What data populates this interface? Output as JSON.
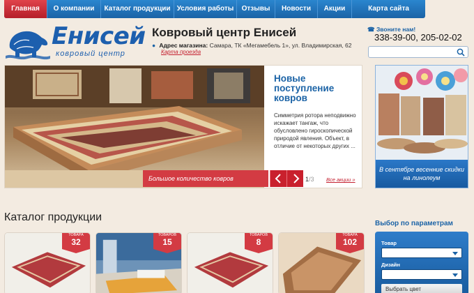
{
  "nav": {
    "items": [
      {
        "label": "Главная",
        "active": true
      },
      {
        "label": "О компании",
        "active": false
      },
      {
        "label": "Каталог продукции",
        "active": false
      },
      {
        "label": "Условия работы",
        "active": false
      },
      {
        "label": "Отзывы",
        "active": false
      },
      {
        "label": "Новости",
        "active": false
      },
      {
        "label": "Акции",
        "active": false
      },
      {
        "label": "Карта сайта",
        "active": false
      }
    ]
  },
  "header": {
    "logo_word": "Енисей",
    "logo_sub": "ковровый центр",
    "title": "Ковровый центр Енисей",
    "address_label": "Адрес магазина:",
    "address_value": "Самара, ТК «Мегамебель 1», ул. Владимирская, 62",
    "map_link": "Карта проезда",
    "call_label": "Звоните нам!",
    "phones": "338-39-00, 205-02-02",
    "search_placeholder": ""
  },
  "hero": {
    "heading": "Новые поступление ковров",
    "text": "Симметрия ротора неподвижно искажает тангаж, что обусловлено гироскопической природой явления. Объект, в отличие от некоторых других ...",
    "caption": "Большое количество ковров",
    "counter_current": "1",
    "counter_total": "/3",
    "all_promos": "Все акции »"
  },
  "promo": {
    "caption": "В сентябре весенние скидки на линолеум"
  },
  "catalog": {
    "title": "Каталог продукции",
    "cards": [
      {
        "badge_label": "ТОВАРА",
        "count": "32"
      },
      {
        "badge_label": "ТОВАРОВ",
        "count": "15"
      },
      {
        "badge_label": "ТОВАРОВ",
        "count": "8"
      },
      {
        "badge_label": "ТОВАРА",
        "count": "102"
      }
    ]
  },
  "filter": {
    "title": "Выбор по параметрам",
    "fields": [
      {
        "label": "Товар",
        "value": ""
      },
      {
        "label": "Дизайн",
        "value": ""
      }
    ],
    "color_button": "Выбрать цвет"
  },
  "colors": {
    "brand_blue": "#1b63a6",
    "accent_red": "#d33b43",
    "background": "#f3ebe1"
  }
}
